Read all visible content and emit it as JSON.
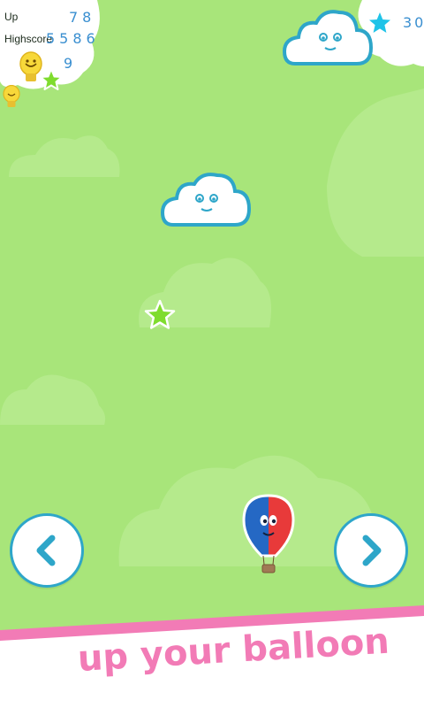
{
  "hud": {
    "up_label": "Up",
    "up_value": "78",
    "highscore_label": "Highscore",
    "highscore_value": "5586",
    "bulb_count": "9",
    "star_count": "30"
  },
  "banner": {
    "text": "up your balloon"
  },
  "colors": {
    "background": "#a8e57a",
    "cloud_outline": "#2ea6c9",
    "banner_pink": "#f27bb6",
    "balloon_blue": "#2568c4",
    "balloon_red": "#e83a3a",
    "star_green": "#7fdc2e"
  },
  "icons": {
    "left": "chevron-left-icon",
    "right": "chevron-right-icon",
    "star": "star-icon",
    "bulb": "lightbulb-icon"
  }
}
